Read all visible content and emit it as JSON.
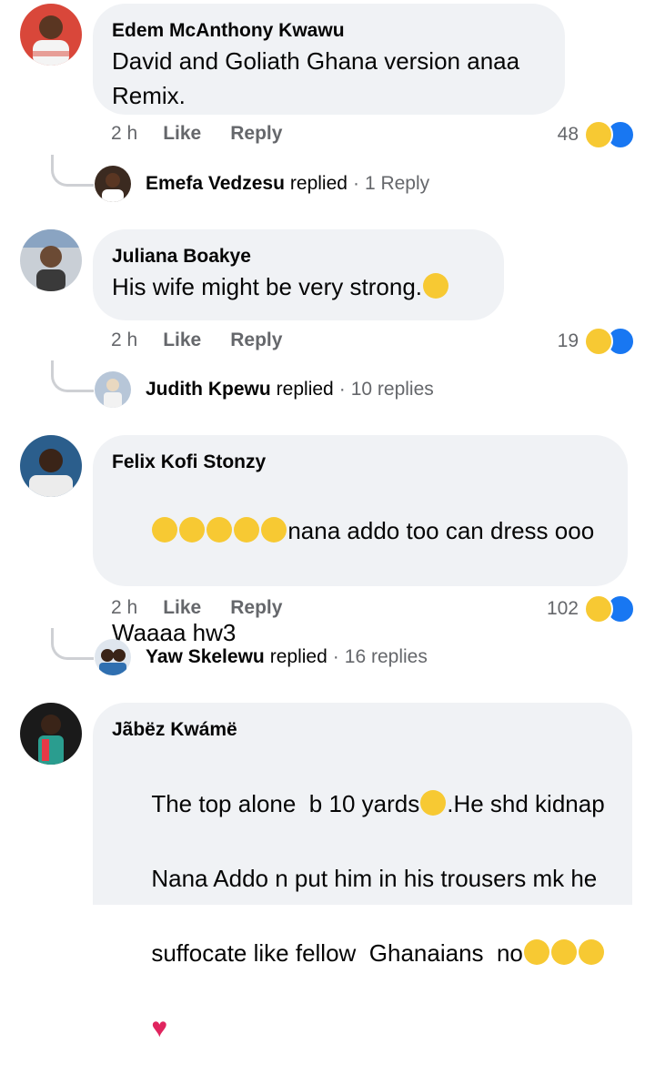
{
  "comments": [
    {
      "author": "Edem McAnthony Kwawu",
      "text": "David and Goliath Ghana version anaa\nRemix.",
      "time": "2 h",
      "like_label": "Like",
      "reply_label": "Reply",
      "reaction_count": "48",
      "reply_author": "Emefa Vedzesu",
      "reply_verb": "replied",
      "reply_count": "1 Reply"
    },
    {
      "author": "Juliana Boakye",
      "text": "His wife might be very strong.",
      "time": "2 h",
      "like_label": "Like",
      "reply_label": "Reply",
      "reaction_count": "19",
      "reply_author": "Judith Kpewu",
      "reply_verb": "replied",
      "reply_count": "10 replies"
    },
    {
      "author": "Felix Kofi Stonzy",
      "text_line1": "nana addo too can dress ooo",
      "text_line2": "Waaaa hw3",
      "time": "2 h",
      "like_label": "Like",
      "reply_label": "Reply",
      "reaction_count": "102",
      "reply_author": "Yaw Skelewu",
      "reply_verb": "replied",
      "reply_count": "16 replies"
    },
    {
      "author": "Jãbëz Kwámë",
      "text_part1": "The top alone  b 10 yards",
      "text_part2": ".He shd kidnap",
      "text_line2": "Nana Addo n put him in his trousers mk he",
      "text_line3": "suffocate like fellow  Ghanaians  no"
    }
  ],
  "colors": {
    "bubble": "#f0f2f5",
    "meta": "#65676b",
    "like_blue": "#1877f2",
    "haha_yellow": "#f7c933",
    "heart_red": "#e0245e"
  },
  "icons": {
    "haha": "haha-reaction-icon",
    "like": "like-reaction-icon",
    "heart": "heart-emoji-icon"
  }
}
